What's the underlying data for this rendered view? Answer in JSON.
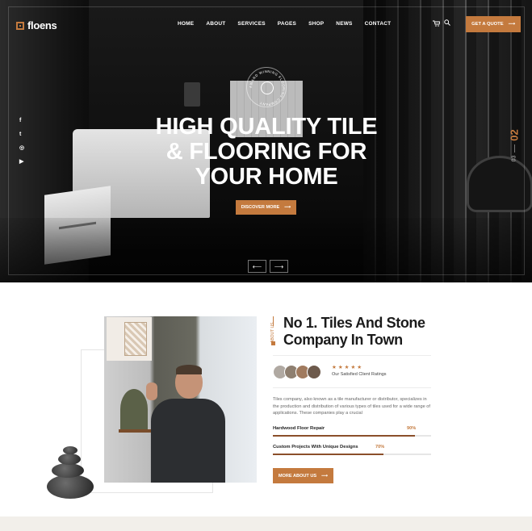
{
  "brand": {
    "name": "floens",
    "accent": "#c47a3e"
  },
  "nav": {
    "items": [
      "HOME",
      "ABOUT",
      "SERVICES",
      "PAGES",
      "SHOP",
      "NEWS",
      "CONTACT"
    ],
    "cart_icon": "cart-icon",
    "search_icon": "search-icon",
    "quote_label": "GET A QUOTE",
    "quote_arrow": "⟶"
  },
  "social": [
    "f",
    "t",
    "◎",
    "▶"
  ],
  "hero": {
    "badge_text": "AWARD WINNING FLOORING COMPANY",
    "title": "HIGH QUALITY TILE & FLOORING FOR YOUR HOME",
    "cta_label": "DISCOVER MORE",
    "cta_arrow": "⟶",
    "prev_arrow": "⟵",
    "next_arrow": "⟶",
    "slide_current": "02",
    "slide_total": "03"
  },
  "about": {
    "section_label": "ABOUT US",
    "title": "No 1. Tiles And Stone Company In Town",
    "stars": "★★★★★",
    "ratings_text": "Our Satisfied Client Ratings",
    "description": "Tiles company, also known as a tile manufacturer or distributor, specializes in the production and distribution of various types of tiles used for a wide range of applications. These companies play a crucial",
    "skills": [
      {
        "label": "Hardwood Floor Repair",
        "percent_text": "90%",
        "value": 0.9
      },
      {
        "label": "Custom Projects With Unique Designs",
        "percent_text": "70%",
        "value": 0.7
      }
    ],
    "cta_label": "MORE ABOUT US",
    "cta_arrow": "⟶"
  }
}
